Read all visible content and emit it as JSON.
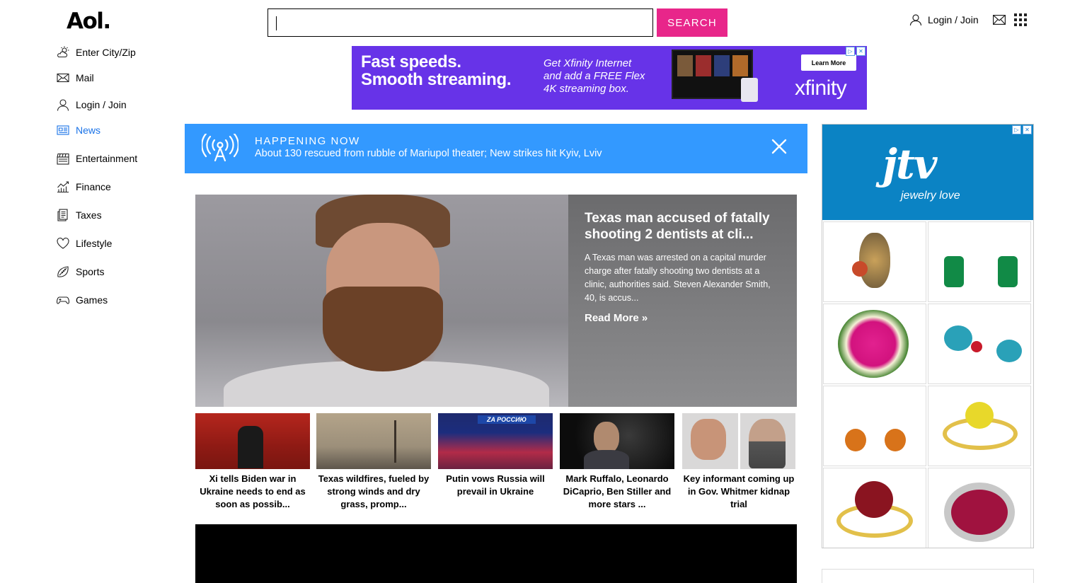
{
  "header": {
    "logo": "Aol.",
    "search_button": "SEARCH",
    "search_value": "",
    "login_label": "Login / Join"
  },
  "sidebar": {
    "items": [
      {
        "label": "Enter City/Zip",
        "icon": "weather-icon"
      },
      {
        "label": "Mail",
        "icon": "mail-icon"
      },
      {
        "label": "Login / Join",
        "icon": "user-icon"
      },
      {
        "label": "News",
        "icon": "news-icon",
        "active": true
      },
      {
        "label": "Entertainment",
        "icon": "clapperboard-icon"
      },
      {
        "label": "Finance",
        "icon": "chart-icon"
      },
      {
        "label": "Taxes",
        "icon": "receipt-icon"
      },
      {
        "label": "Lifestyle",
        "icon": "heart-icon"
      },
      {
        "label": "Sports",
        "icon": "football-icon"
      },
      {
        "label": "Games",
        "icon": "gamepad-icon"
      }
    ],
    "active_color": "#1a73e8"
  },
  "ad_top": {
    "headline_line1": "Fast speeds.",
    "headline_line2": "Smooth streaming.",
    "sub_line1": "Get Xfinity Internet",
    "sub_line2": "and add a FREE Flex",
    "sub_line3": "4K streaming box.",
    "cta": "Learn More",
    "brand": "xfinity",
    "bg_color": "#6733e8"
  },
  "happening": {
    "label": "HAPPENING NOW",
    "text": "About 130 rescued from rubble of Mariupol theater; New strikes hit Kyiv, Lviv",
    "bg_color": "#3399ff"
  },
  "hero": {
    "title": "Texas man accused of fatally shooting 2 dentists at cli...",
    "description": "A Texas man was arrested on a capital murder charge after fatally shooting two dentists at a clinic, authorities said. Steven Alexander Smith, 40, is accus...",
    "read_more": "Read More »"
  },
  "thumbnails": [
    {
      "caption": "Xi tells Biden war in Ukraine needs to end as soon as possib..."
    },
    {
      "caption": "Texas wildfires, fueled by strong winds and dry grass, promp..."
    },
    {
      "caption": "Putin vows Russia will prevail in Ukraine",
      "overlay": "ZA РОССИЮ"
    },
    {
      "caption": "Mark Ruffalo, Leonardo DiCaprio, Ben Stiller and more stars ..."
    },
    {
      "caption": "Key informant coming up in Gov. Whitmer kidnap trial"
    }
  ],
  "ad_right": {
    "brand": "jtv",
    "tagline": "jewelry love",
    "brand_color": "#0b83c4"
  },
  "colors": {
    "search_button": "#e8268a"
  }
}
